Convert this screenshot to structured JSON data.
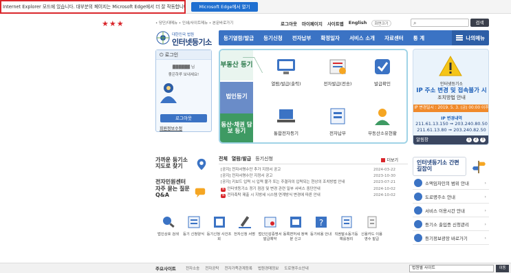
{
  "ie_notice": {
    "message": "Internet Explorer 모드에 있습니다. 대부분의 페이지는 Microsoft Edge에서 더 잘 작동합니다.",
    "button": "Microsoft Edge에서 열기"
  },
  "stars": "★★★",
  "utility": {
    "breadcrumb": "• 당단/대메뉴 • 인쇄/사이트메뉴 • 본문바로가기",
    "links": [
      "로그아웃",
      "마이페이지",
      "사이트맵",
      "English"
    ],
    "zoom_label": "화면크기",
    "search_button": "검색"
  },
  "logo": {
    "org": "대한민국 법원",
    "name": "인터넷등기소"
  },
  "gnb": {
    "items": [
      "등기열람/발급",
      "등기신청",
      "전자납부",
      "확정일자",
      "서비스 소개",
      "자료센터",
      "통 계"
    ],
    "my_menu": "나의메뉴"
  },
  "login": {
    "header": "로그인",
    "user": "좋은하루 보내세요!",
    "logout": "로그아웃",
    "info": "회원정보수정"
  },
  "services": {
    "tabs": [
      "부동산 등기",
      "법인등기",
      "동산·채권 담보 등기"
    ],
    "items": [
      "열람/발급(출력)",
      "전자발급(전송)",
      "발급확인",
      "통합전자등기",
      "전자납부",
      "부동산소유현황"
    ]
  },
  "banner": {
    "line1": "인터넷등기소",
    "line2": "IP 주소 변경 및 접속불가 시",
    "line3": "조치방법 안내",
    "date": "IP 변경일시 : 2019. 5. 3. (금) 00:00 이후",
    "ip_title": "IP 변경내역",
    "ip1": "211.61.13.150 ➞ 203.240.80.50",
    "ip2": "211.61.13.80 ➞ 203.240.82.50",
    "footer": "알림창",
    "pages": [
      "1",
      "2",
      "3"
    ]
  },
  "left_links": {
    "b1": "가까운 등기소 지도로 찾기",
    "b2": "전자민원센터",
    "b3": "자주 묻는 질문 Q&A"
  },
  "notice": {
    "tabs": [
      "전체",
      "열람/발급",
      "등기신청"
    ],
    "more": "더보기",
    "items": [
      {
        "text": "[공지] 전자서명수단 추가 지정서 공고",
        "date": "2024-03-22",
        "new": false
      },
      {
        "text": "[공지] 전자서명수단 지정서 공고",
        "date": "2023-10-30",
        "new": false
      },
      {
        "text": "[공지] 키보드 입력 시 입력 불가 또는 주결자의 입력되는 현상의 조치방법 안내",
        "date": "2023-07-21",
        "new": false
      },
      {
        "text": "인터넷등기소 정기 점검 및 변경 관련 일부 서비스 중단안내",
        "date": "2024-10-02",
        "new": true
      },
      {
        "text": "전자촉탁 제출 시 지방세 시스템 연계방식 변경에 따른 안내",
        "date": "2024-10-02",
        "new": true
      }
    ]
  },
  "right_links": {
    "title": "인터넷등기소 간편길잡이",
    "items": [
      "소액임차인의 범위 안내",
      "도로명주소 안내",
      "서비스 이용시간 안내",
      "등기소 출입증 신청관리",
      "등기정보광장 바로가기"
    ]
  },
  "quick": [
    "법인상호 검색",
    "등기 신청양식",
    "등기신청 사건조회",
    "전자신청 서명",
    "법인인감증명서 발급예약",
    "동록면허세 정액분 신고",
    "등기비용 안내",
    "직권말소동기등 예를정리",
    "신용카드 이용 영수 발급"
  ],
  "footer": {
    "label": "주요사이트",
    "links": [
      "전자소송",
      "전자공탁",
      "전자가족관계등록",
      "법원경매정보",
      "도로명주소안내"
    ],
    "select": "법원별 사이트",
    "go": "이동"
  }
}
